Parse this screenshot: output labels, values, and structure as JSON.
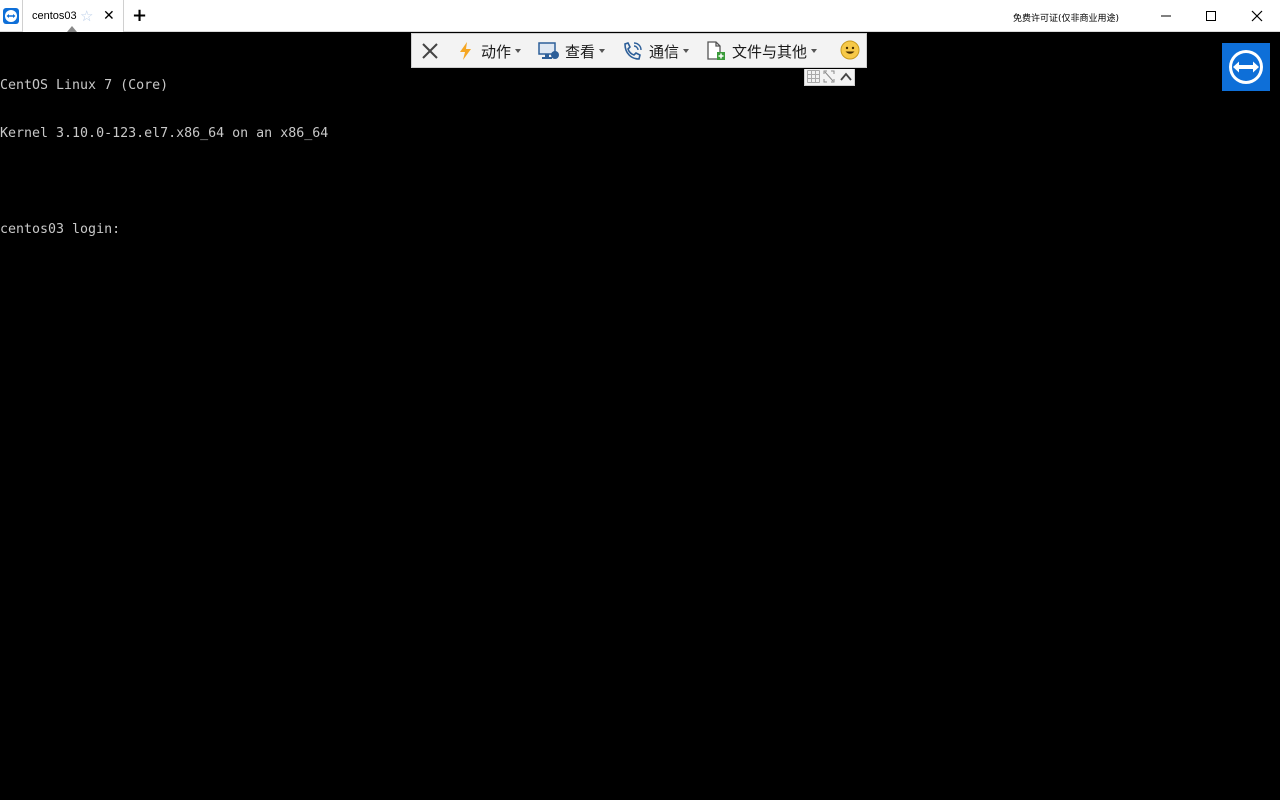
{
  "titlebar": {
    "tab_title": "centos03",
    "license_text": "免费许可证(仅非商业用途)",
    "icons": {
      "app": "teamviewer-icon",
      "favorite": "star-icon",
      "close_tab": "close-icon",
      "new_tab": "plus-icon",
      "minimize": "minimize-icon",
      "maximize": "maximize-icon",
      "close_window": "close-icon"
    }
  },
  "terminal": {
    "lines": [
      "CentOS Linux 7 (Core)",
      "Kernel 3.10.0-123.el7.x86_64 on an x86_64",
      "",
      "centos03 login: "
    ]
  },
  "toolbar": {
    "items": [
      {
        "label": "动作",
        "icon": "lightning-icon"
      },
      {
        "label": "查看",
        "icon": "monitor-icon"
      },
      {
        "label": "通信",
        "icon": "phone-icon"
      },
      {
        "label": "文件与其他",
        "icon": "file-icon"
      }
    ],
    "icons": {
      "close": "close-icon",
      "smiley": "smiley-icon",
      "grid": "grid-icon",
      "expand": "expand-icon",
      "collapse": "chevron-up-icon"
    }
  },
  "colors": {
    "accent": "#0e6fd8",
    "terminal_text": "#c8c8c8",
    "terminal_bg": "#000000",
    "lightning": "#f5a623"
  }
}
